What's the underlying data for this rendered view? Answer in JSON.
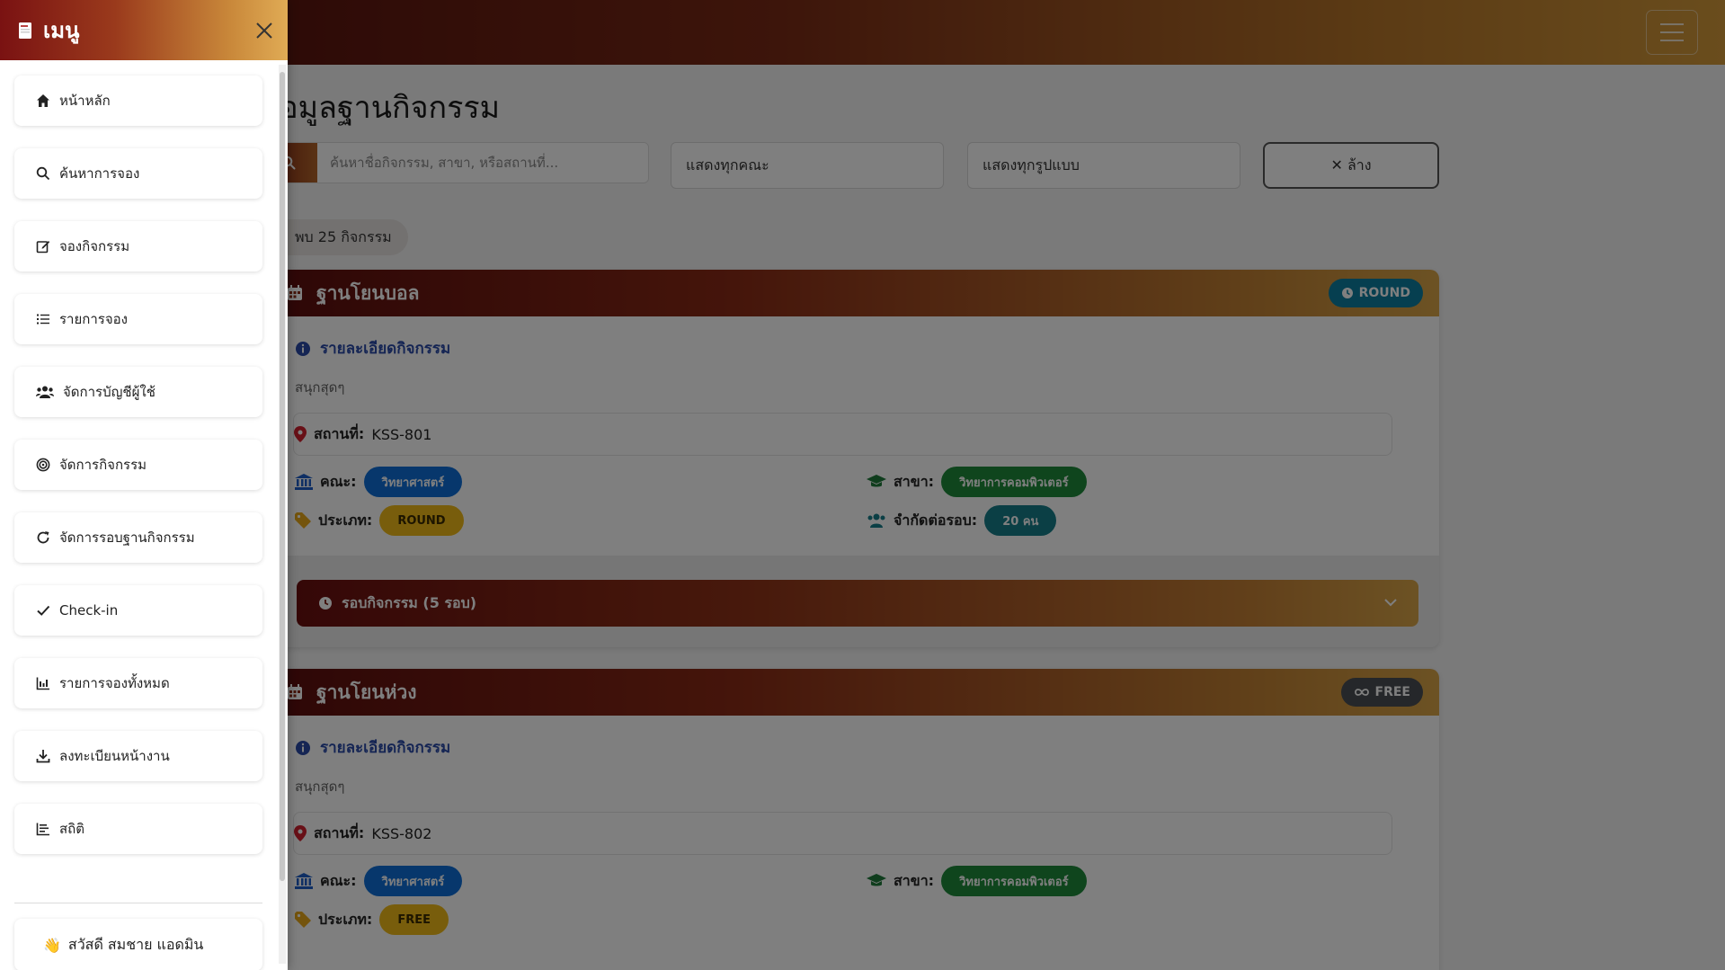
{
  "sidebar": {
    "title": "เมนู",
    "items": [
      {
        "label": "หน้าหลัก",
        "icon": "home-icon"
      },
      {
        "label": "ค้นหาการจอง",
        "icon": "search-icon"
      },
      {
        "label": "จองกิจกรรม",
        "icon": "edit-icon"
      },
      {
        "label": "รายการจอง",
        "icon": "list-icon"
      },
      {
        "label": "จัดการบัญชีผู้ใช้",
        "icon": "users-icon"
      },
      {
        "label": "จัดการกิจกรรม",
        "icon": "target-icon"
      },
      {
        "label": "จัดการรอบฐานกิจกรรม",
        "icon": "refresh-icon"
      },
      {
        "label": "Check-in",
        "icon": "check-icon"
      },
      {
        "label": "รายการจองทั้งหมด",
        "icon": "chart-icon"
      },
      {
        "label": "ลงทะเบียนหน้างาน",
        "icon": "download-icon"
      },
      {
        "label": "สถิติ",
        "icon": "stats-icon"
      }
    ],
    "user_greeting": "สวัสดี สมชาย แอดมิน"
  },
  "page": {
    "title": "ข้อมูลฐานกิจกรรม",
    "search_placeholder": "ค้นหาชื่อกิจกรรม, สาขา, หรือสถานที่...",
    "faculty_filter": "แสดงทุกคณะ",
    "type_filter": "แสดงทุกรูปแบบ",
    "clear_label": "✕ ล้าง",
    "count_text": "พบ 25 กิจกรรม"
  },
  "cards": [
    {
      "title": "ฐานโยนบอล",
      "badge": "ROUND",
      "detail_head": "รายละเอียดกิจกรรม",
      "description": "สนุกสุดๆ",
      "place_label": "สถานที่:",
      "place": "KSS-801",
      "faculty_label": "คณะ:",
      "faculty": "วิทยาศาสตร์",
      "major_label": "สาขา:",
      "major": "วิทยาการคอมพิวเตอร์",
      "type_label": "ประเภท:",
      "type": "ROUND",
      "limit_label": "จำกัดต่อรอบ:",
      "limit": "20 คน",
      "rounds_label": "รอบกิจกรรม (5 รอบ)"
    },
    {
      "title": "ฐานโยนห่วง",
      "badge": "FREE",
      "detail_head": "รายละเอียดกิจกรรม",
      "description": "สนุกสุดๆ",
      "place_label": "สถานที่:",
      "place": "KSS-802",
      "faculty_label": "คณะ:",
      "faculty": "วิทยาศาสตร์",
      "major_label": "สาขา:",
      "major": "วิทยาการคอมพิวเตอร์",
      "type_label": "ประเภท:",
      "type": "FREE"
    }
  ],
  "colors": {
    "brand_dark": "#5a0d0d",
    "brand_gold": "#d9a548",
    "faculty_pill": "#0f6fd8",
    "major_pill": "#1e8a3a",
    "type_pill": "#f1bb18",
    "round_badge": "#0d7ea0",
    "free_badge": "#4a4f55"
  }
}
